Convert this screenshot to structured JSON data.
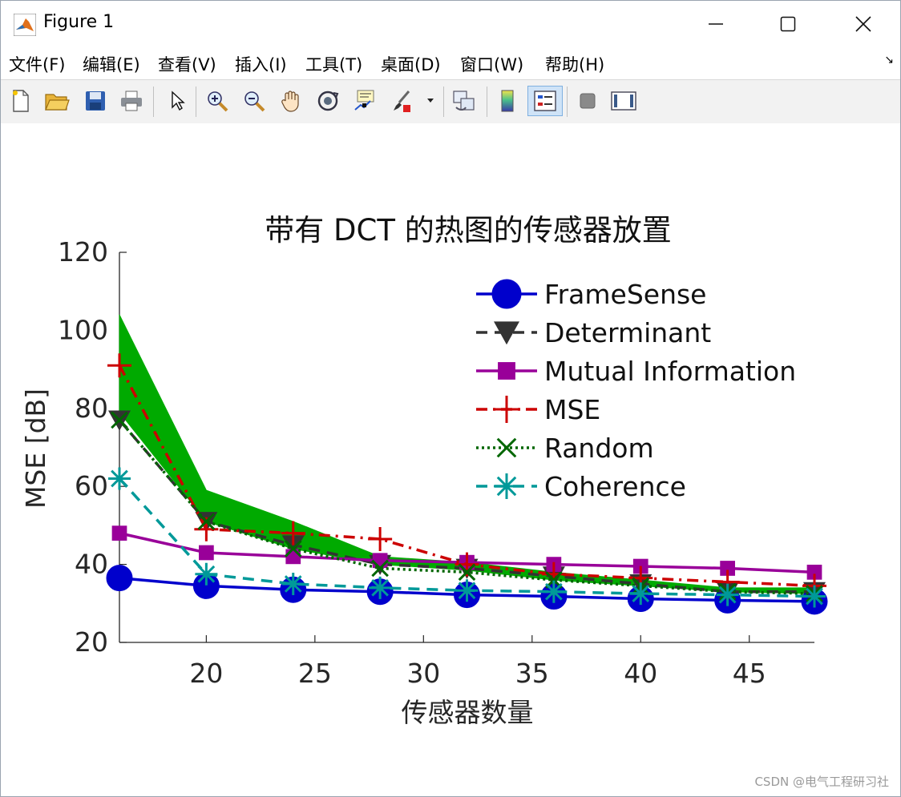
{
  "window": {
    "title": "Figure 1",
    "controls": {
      "minimize": "—",
      "maximize": "☐",
      "close": "✕"
    }
  },
  "menu": {
    "items": [
      "文件(F)",
      "编辑(E)",
      "查看(V)",
      "插入(I)",
      "工具(T)",
      "桌面(D)",
      "窗口(W)",
      "帮助(H)"
    ],
    "corner_glyph": "↘"
  },
  "toolbar": {
    "buttons": [
      "new-figure-icon",
      "open-file-icon",
      "save-icon",
      "print-icon",
      "select-arrow-icon",
      "zoom-in-icon",
      "zoom-out-icon",
      "pan-hand-icon",
      "rotate-3d-icon",
      "data-cursor-icon",
      "brush-icon",
      "brush-dropdown-icon",
      "link-plot-icon",
      "colorbar-icon",
      "legend-icon",
      "hide-plot-tools-icon",
      "show-plot-tools-icon"
    ],
    "active": "legend-icon"
  },
  "chart_data": {
    "type": "line",
    "title": "带有 DCT 的热图的传感器放置",
    "xlabel": "传感器数量",
    "ylabel": "MSE [dB]",
    "xlim": [
      16,
      48
    ],
    "ylim": [
      20,
      120
    ],
    "xticks": [
      20,
      25,
      30,
      35,
      40,
      45
    ],
    "yticks": [
      20,
      40,
      60,
      80,
      100,
      120
    ],
    "x": [
      16,
      20,
      24,
      28,
      32,
      36,
      40,
      44,
      48
    ],
    "legend_position": "top-right",
    "series": [
      {
        "name": "FrameSense",
        "color": "#0000cc",
        "line": "solid",
        "marker": "circle",
        "values": [
          36.5,
          34.5,
          33.5,
          33,
          32.2,
          31.8,
          31.2,
          30.8,
          30.5
        ]
      },
      {
        "name": "Determinant",
        "color": "#333333",
        "line": "dashed",
        "marker": "triangle-down",
        "values": [
          77,
          51,
          45,
          40,
          39,
          37,
          35,
          33,
          33
        ]
      },
      {
        "name": "Mutual Information",
        "color": "#990099",
        "line": "solid",
        "marker": "square",
        "values": [
          48,
          43,
          42,
          41,
          40.5,
          40,
          39.5,
          39,
          38
        ]
      },
      {
        "name": "MSE",
        "color": "#cc0000",
        "line": "dashdot",
        "marker": "plus",
        "values": [
          91,
          49,
          48,
          46.5,
          40,
          37.5,
          36.5,
          35.5,
          34.5
        ]
      },
      {
        "name": "Random",
        "color": "#006600",
        "line": "dotted",
        "marker": "x",
        "values": [
          77,
          51,
          44,
          39,
          38,
          36,
          34.5,
          33,
          32.5
        ]
      },
      {
        "name": "Coherence",
        "color": "#009999",
        "line": "dashed",
        "marker": "asterisk",
        "values": [
          62,
          37.5,
          35,
          34,
          33.3,
          33,
          32.5,
          32.2,
          31.8
        ]
      }
    ],
    "band": {
      "color": "#00aa00",
      "upper": [
        104,
        59,
        51,
        42,
        40.5,
        38,
        36,
        34,
        34
      ],
      "lower": [
        79,
        51,
        44,
        40,
        38.5,
        36,
        34.5,
        33,
        32.5
      ]
    }
  },
  "watermark": "CSDN @电气工程研习社"
}
